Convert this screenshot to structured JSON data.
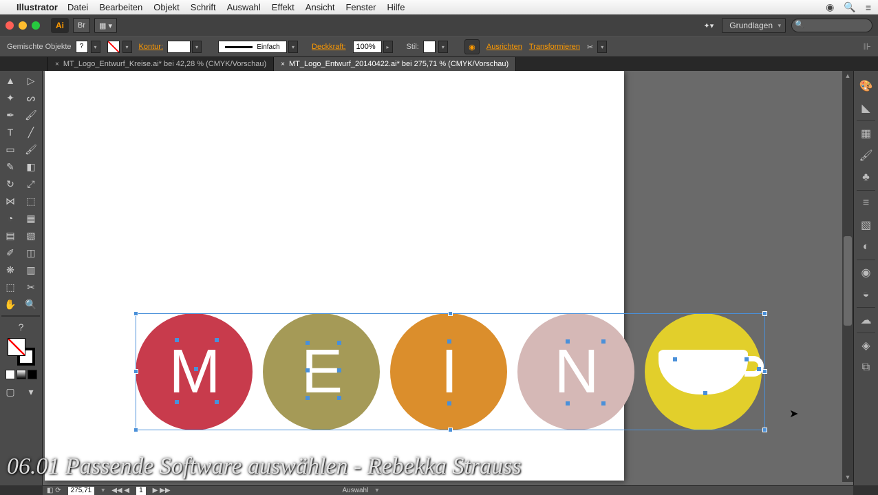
{
  "menubar": {
    "app": "Illustrator",
    "items": [
      "Datei",
      "Bearbeiten",
      "Objekt",
      "Schrift",
      "Auswahl",
      "Effekt",
      "Ansicht",
      "Fenster",
      "Hilfe"
    ]
  },
  "app_chrome": {
    "workspace_label": "Grundlagen"
  },
  "control_bar": {
    "selection_type": "Gemischte Objekte",
    "kontur_label": "Kontur:",
    "stroke_width": "",
    "stroke_style": "Einfach",
    "deckkraft_label": "Deckkraft:",
    "opacity_value": "100%",
    "stil_label": "Stil:",
    "ausrichten": "Ausrichten",
    "transformieren": "Transformieren"
  },
  "tabs": [
    {
      "label": "MT_Logo_Entwurf_Kreise.ai* bei 42,28 % (CMYK/Vorschau)",
      "active": false
    },
    {
      "label": "MT_Logo_Entwurf_20140422.ai* bei 275,71 % (CMYK/Vorschau)",
      "active": true
    }
  ],
  "canvas": {
    "circles": [
      {
        "bg": "#c83b4c",
        "letter": "M"
      },
      {
        "bg": "#a59a57",
        "letter": "E"
      },
      {
        "bg": "#db8e2c",
        "letter": "I"
      },
      {
        "bg": "#d5b8b6",
        "letter": "N"
      },
      {
        "bg": "#e2cf2b",
        "letter": ""
      }
    ]
  },
  "status": {
    "zoom": "275,71",
    "artboard_no": "1",
    "selection_label": "Auswahl"
  },
  "caption": "06.01 Passende Software auswählen - Rebekka Strauss"
}
